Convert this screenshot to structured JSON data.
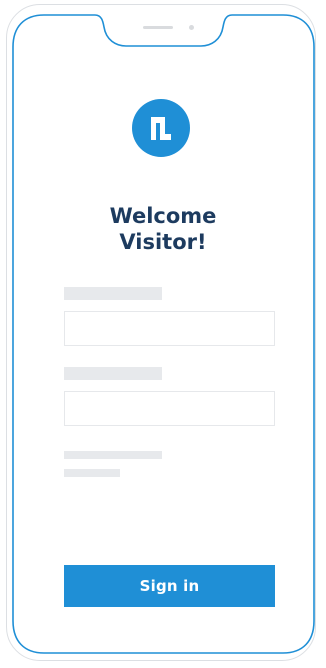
{
  "welcome": {
    "line1": "Welcome",
    "line2": "Visitor!"
  },
  "signin": {
    "label": "Sign in"
  },
  "colors": {
    "accent": "#1f8fd6",
    "title": "#1d3b5f",
    "placeholder_bar": "#e7e9ec",
    "outline": "#1f8fd6"
  },
  "icons": {
    "logo": "brand-logo-icon"
  }
}
